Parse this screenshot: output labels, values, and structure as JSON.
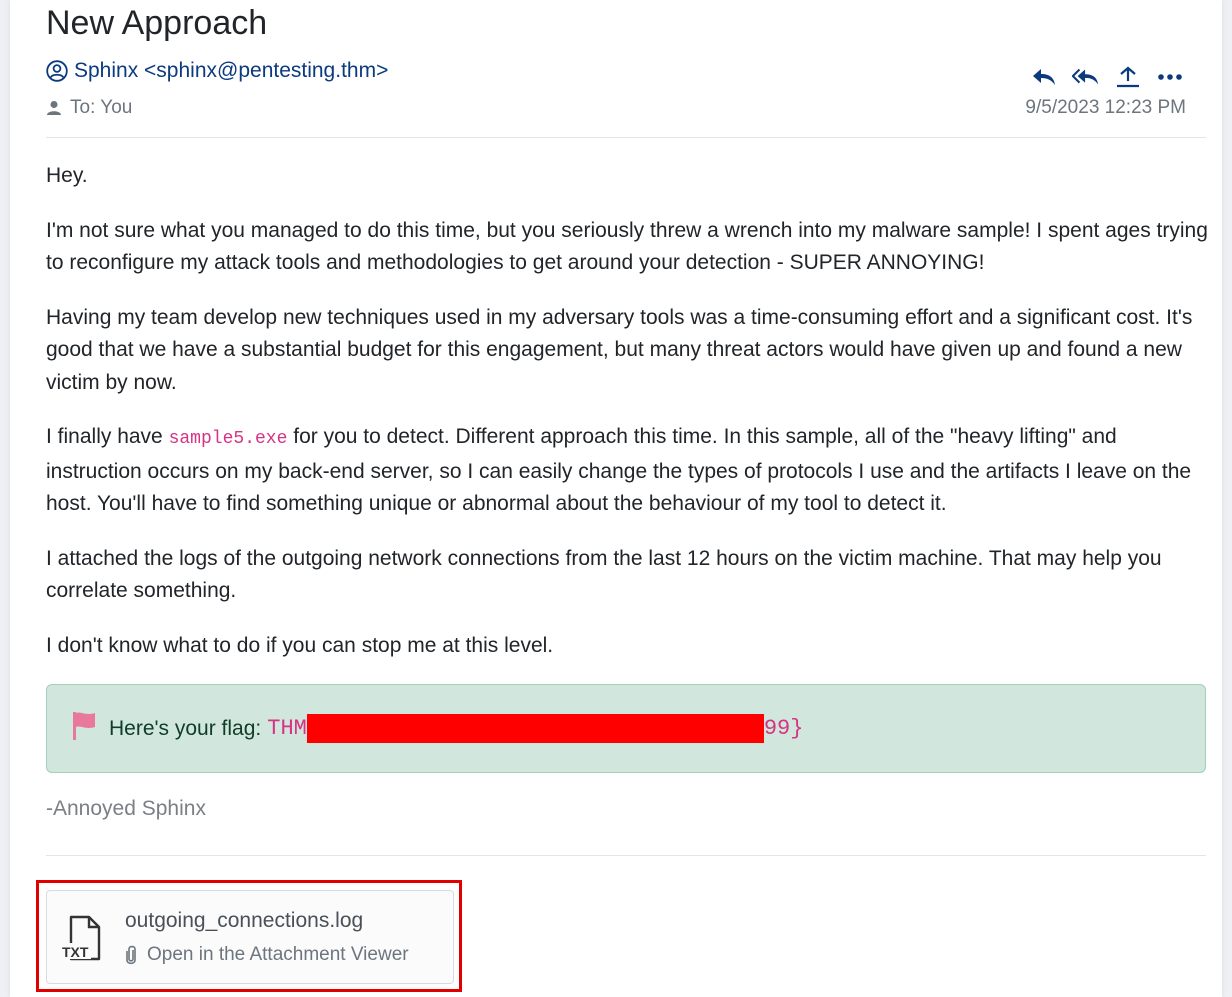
{
  "email": {
    "subject": "New Approach",
    "sender": "Sphinx <sphinx@pentesting.thm>",
    "to": "To: You",
    "date": "9/5/2023 12:23 PM",
    "actions": [
      "reply-icon",
      "reply-all-icon",
      "forward-icon",
      "more-icon"
    ]
  },
  "body": {
    "greeting": "Hey.",
    "p1": "I'm not sure what you managed to do this time, but you seriously threw a wrench into my malware sample! I spent ages trying to reconfigure my attack tools and methodologies to get around your detection - SUPER ANNOYING!",
    "p2": "Having my team develop new techniques used in my adversary tools was a time-consuming effort and a significant cost. It's good that we have a substantial budget for this engagement, but many threat actors would have given up and found a new victim by now.",
    "p3_before": "I finally have ",
    "p3_code": "sample5.exe",
    "p3_after": " for you to detect. Different approach this time. In this sample, all of the \"heavy lifting\" and instruction occurs on my back-end server, so I can easily change the types of protocols I use and the artifacts I leave on the host. You'll have to find something unique or abnormal about the behaviour of my tool to detect it.",
    "p4": "I attached the logs of the outgoing network connections from the last 12 hours on the victim machine. That may help you correlate something.",
    "p5": "I don't know what to do if you can stop me at this level."
  },
  "flag": {
    "label": "Here's your flag:",
    "prefix": "THM",
    "suffix": "99}"
  },
  "signature": "-Annoyed Sphinx",
  "attachment": {
    "filename": "outgoing_connections.log",
    "file_type": "TXT",
    "open_label": "Open in the Attachment Viewer"
  },
  "colors": {
    "link": "#0b3a7e",
    "code": "#d63384",
    "flag_bg": "#d1e7dd",
    "redaction": "#ff0000",
    "highlight_outline": "#e00000"
  }
}
